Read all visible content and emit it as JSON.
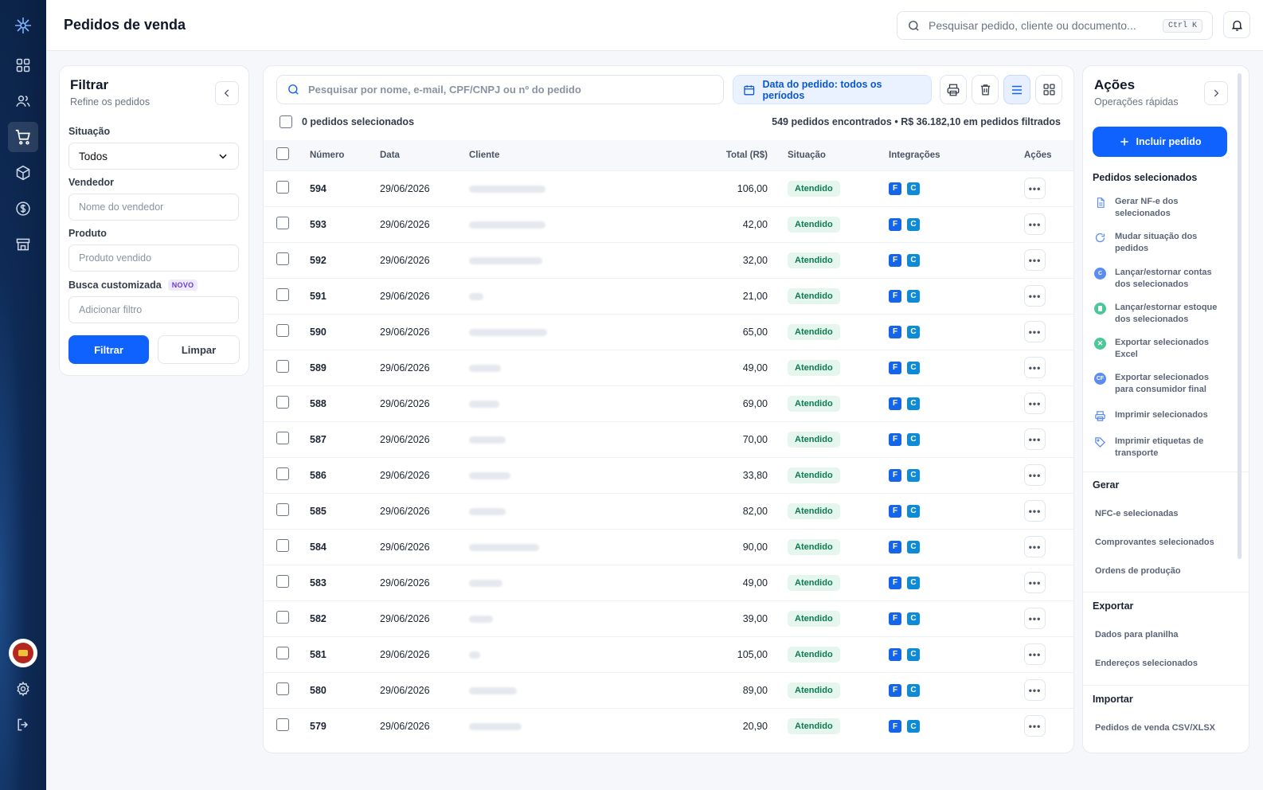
{
  "header": {
    "title": "Pedidos de venda",
    "search_placeholder": "Pesquisar pedido, cliente ou documento...",
    "search_shortcut": "Ctrl K"
  },
  "filter": {
    "title": "Filtrar",
    "subtitle": "Refine os pedidos",
    "situacao_label": "Situação",
    "situacao_value": "Todos",
    "vendedor_label": "Vendedor",
    "vendedor_placeholder": "Nome do vendedor",
    "produto_label": "Produto",
    "produto_placeholder": "Produto vendido",
    "busca_label": "Busca customizada",
    "busca_badge": "NOVO",
    "busca_placeholder": "Adicionar filtro",
    "filter_button": "Filtrar",
    "clear_button": "Limpar"
  },
  "list": {
    "search_placeholder": "Pesquisar por nome, e-mail, CPF/CNPJ ou nº do pedido",
    "date_filter": "Data do pedido: todos os períodos",
    "selected_count": "0 pedidos selecionados",
    "summary": "549 pedidos encontrados • R$ 36.182,10 em pedidos filtrados",
    "columns": {
      "numero": "Número",
      "data": "Data",
      "cliente": "Cliente",
      "total": "Total (R$)",
      "situacao": "Situação",
      "integracoes": "Integrações",
      "acoes": "Ações"
    },
    "rows": [
      {
        "numero": "594",
        "data": "29/06/2026",
        "total": "106,00",
        "situacao": "Atendido"
      },
      {
        "numero": "593",
        "data": "29/06/2026",
        "total": "42,00",
        "situacao": "Atendido"
      },
      {
        "numero": "592",
        "data": "29/06/2026",
        "total": "32,00",
        "situacao": "Atendido"
      },
      {
        "numero": "591",
        "data": "29/06/2026",
        "total": "21,00",
        "situacao": "Atendido"
      },
      {
        "numero": "590",
        "data": "29/06/2026",
        "total": "65,00",
        "situacao": "Atendido"
      },
      {
        "numero": "589",
        "data": "29/06/2026",
        "total": "49,00",
        "situacao": "Atendido"
      },
      {
        "numero": "588",
        "data": "29/06/2026",
        "total": "69,00",
        "situacao": "Atendido"
      },
      {
        "numero": "587",
        "data": "29/06/2026",
        "total": "70,00",
        "situacao": "Atendido"
      },
      {
        "numero": "586",
        "data": "29/06/2026",
        "total": "33,80",
        "situacao": "Atendido"
      },
      {
        "numero": "585",
        "data": "29/06/2026",
        "total": "82,00",
        "situacao": "Atendido"
      },
      {
        "numero": "584",
        "data": "29/06/2026",
        "total": "90,00",
        "situacao": "Atendido"
      },
      {
        "numero": "583",
        "data": "29/06/2026",
        "total": "49,00",
        "situacao": "Atendido"
      },
      {
        "numero": "582",
        "data": "29/06/2026",
        "total": "39,00",
        "situacao": "Atendido"
      },
      {
        "numero": "581",
        "data": "29/06/2026",
        "total": "105,00",
        "situacao": "Atendido"
      },
      {
        "numero": "580",
        "data": "29/06/2026",
        "total": "89,00",
        "situacao": "Atendido"
      },
      {
        "numero": "579",
        "data": "29/06/2026",
        "total": "20,90",
        "situacao": "Atendido"
      }
    ],
    "integration_f": "F",
    "integration_c": "C",
    "row_menu": "•••"
  },
  "actions": {
    "title": "Ações",
    "subtitle": "Operações rápidas",
    "add_button": "Incluir pedido",
    "selected_section": "Pedidos selecionados",
    "selected_items": [
      "Gerar NF-e dos selecionados",
      "Mudar situação dos pedidos",
      "Lançar/estornar contas dos selecionados",
      "Lançar/estornar estoque dos selecionados",
      "Exportar selecionados Excel",
      "Exportar selecionados para consumidor final",
      "Imprimir selecionados",
      "Imprimir etiquetas de transporte"
    ],
    "icon_c": "C",
    "icon_cf": "CF",
    "gerar_section": "Gerar",
    "gerar_items": [
      "NFC-e selecionadas",
      "Comprovantes selecionados",
      "Ordens de produção"
    ],
    "exportar_section": "Exportar",
    "exportar_items": [
      "Dados para planilha",
      "Endereços selecionados"
    ],
    "importar_section": "Importar",
    "importar_items": [
      "Pedidos de venda CSV/XLSX"
    ]
  },
  "colors": {
    "primary": "#0f62fe",
    "rail": "#0a1f40",
    "status_bg": "#e5f6ef",
    "status_text": "#0d7a52"
  }
}
